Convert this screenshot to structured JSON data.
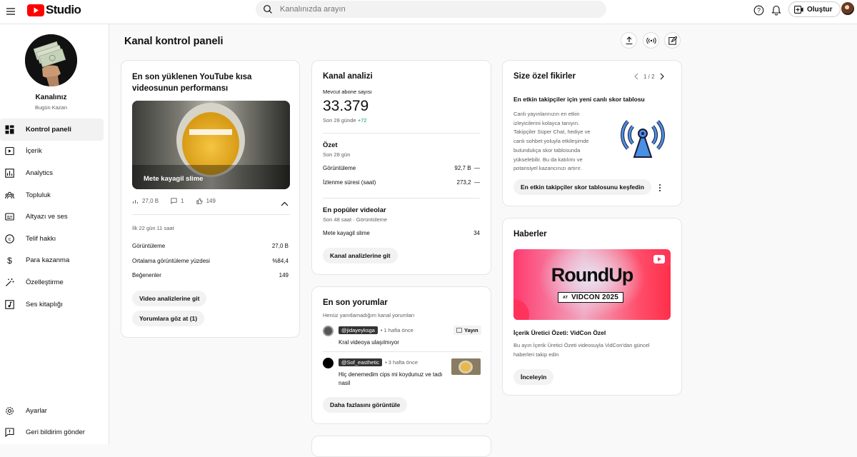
{
  "app": {
    "logo_text": "Studio"
  },
  "search": {
    "placeholder": "Kanalınızda arayın"
  },
  "topbar": {
    "create_label": "Oluştur"
  },
  "channel": {
    "name": "Kanalınız",
    "subtitle": "Bugün Kazan"
  },
  "sidebar": {
    "items": [
      {
        "label": "Kontrol paneli",
        "icon": "dashboard-icon"
      },
      {
        "label": "İçerik",
        "icon": "content-icon"
      },
      {
        "label": "Analytics",
        "icon": "analytics-icon"
      },
      {
        "label": "Topluluk",
        "icon": "community-icon"
      },
      {
        "label": "Altyazı ve ses",
        "icon": "subtitles-icon"
      },
      {
        "label": "Telif hakkı",
        "icon": "copyright-icon"
      },
      {
        "label": "Para kazanma",
        "icon": "dollar-icon"
      },
      {
        "label": "Özelleştirme",
        "icon": "magic-wand-icon"
      },
      {
        "label": "Ses kitaplığı",
        "icon": "audio-library-icon"
      }
    ],
    "bottom": [
      {
        "label": "Ayarlar",
        "icon": "gear-icon"
      },
      {
        "label": "Geri bildirim gönder",
        "icon": "feedback-icon"
      }
    ]
  },
  "page": {
    "title": "Kanal kontrol paneli"
  },
  "latest_short": {
    "title": "En son yüklenen YouTube kısa videosunun performansı",
    "thumb_title": "Mete kayagil slime",
    "stats": {
      "views": "27,0 B",
      "comments": "1",
      "likes": "149"
    },
    "period": "İlk 22 gün 11 saat",
    "rows": [
      {
        "label": "Görüntüleme",
        "value": "27,0 B"
      },
      {
        "label": "Ortalama görüntüleme yüzdesi",
        "value": "%84,4"
      },
      {
        "label": "Beğenenler",
        "value": "149"
      }
    ],
    "btn_analytics": "Video analizlerine git",
    "btn_comments": "Yorumlara göz at (1)"
  },
  "analytics": {
    "title": "Kanal analizi",
    "subs_label": "Mevcut abone sayısı",
    "subs_value": "33.379",
    "subs_period": "Son 28 günde",
    "subs_delta": "+72",
    "summary_title": "Özet",
    "summary_period": "Son 28 gün",
    "summary_rows": [
      {
        "label": "Görüntüleme",
        "value": "92,7 B",
        "trend": "—"
      },
      {
        "label": "İzlenme süresi (saat)",
        "value": "273,2",
        "trend": "—"
      }
    ],
    "top_title": "En popüler videolar",
    "top_period": "Son 48 saat · Görüntüleme",
    "top_rows": [
      {
        "label": "Mete kayagil slime",
        "value": "34"
      }
    ],
    "btn": "Kanal analizlerine git"
  },
  "comments": {
    "title": "En son yorumlar",
    "subtitle": "Henüz yanıtlamadığım kanal yorumları",
    "items": [
      {
        "author": "@jidayeyksga",
        "time": "• 1 hafta önce",
        "text": "Kral videoya ulaşılmıyor",
        "badge": "Yayın"
      },
      {
        "author": "@Sof_easthetic",
        "time": "• 3 hafta önce",
        "text": "Hiç denemedim cips mi koydunuz ve tadı nasil"
      }
    ],
    "btn": "Daha fazlasını görüntüle"
  },
  "ideas": {
    "title": "Size özel fikirler",
    "pager": "1 / 2",
    "heading": "En etkin takipçiler için yeni canlı skor tablosu",
    "body": "Canlı yayınlarınızın en etkin izleyicilerini kolayca tanıyın. Takipçiler Süper Chat, hediye ve canlı sohbet yoluyla etkileşimde bulundukça skor tablosunda yükselebilir. Bu da katılımı ve potansiyel kazancınızı artırır.",
    "btn": "En etkin takipçiler skor tablosunu keşfedin"
  },
  "news": {
    "title": "Haberler",
    "banner_main": "RoundUp",
    "banner_at": "AT",
    "banner_event": "VIDCON 2025",
    "heading": "İçerik Üretici Özeti: VidCon Özel",
    "body": "Bu ayın İçerik Üretici Özeti videosuyla VidCon'dan güncel haberleri takip edin",
    "btn": "İnceleyin"
  },
  "colors": {
    "brand_red": "#ff0000",
    "positive_green": "#0f9d58",
    "banner_pink": "#ff3a6e"
  }
}
